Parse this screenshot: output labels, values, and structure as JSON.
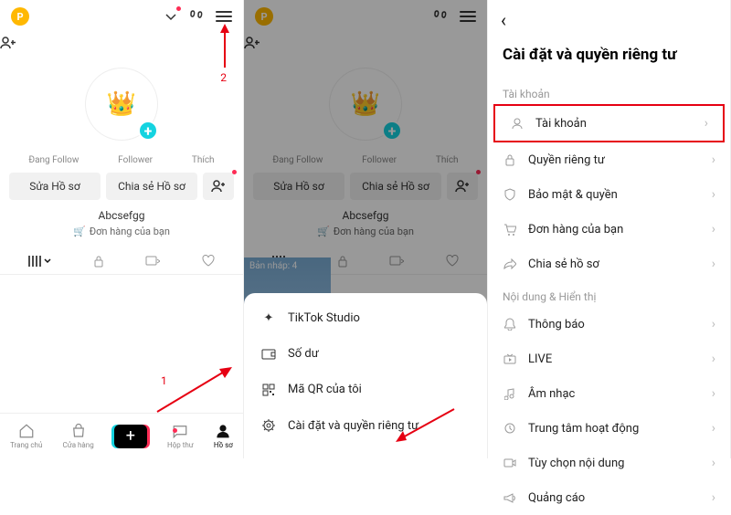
{
  "panel1": {
    "stats": [
      "Đang Follow",
      "Follower",
      "Thích"
    ],
    "buttons": {
      "edit": "Sửa Hồ sơ",
      "share": "Chia sẻ Hồ sơ"
    },
    "username": "Abcsefgg",
    "orders": "Đơn hàng của bạn",
    "nav": {
      "home": "Trang chủ",
      "shop": "Cửa hàng",
      "inbox": "Hộp thư",
      "profile": "Hồ sơ"
    },
    "annot": {
      "n1": "1",
      "n2": "2"
    }
  },
  "panel2": {
    "stats": [
      "Đang Follow",
      "Follower",
      "Thích"
    ],
    "buttons": {
      "edit": "Sửa Hồ sơ",
      "share": "Chia sẻ Hồ sơ"
    },
    "username": "Abcsefgg",
    "orders": "Đơn hàng của bạn",
    "draft": "Bản nháp: 4",
    "sheet": {
      "studio": "TikTok Studio",
      "balance": "Số dư",
      "qr": "Mã QR của tôi",
      "settings": "Cài đặt và quyền riêng tư"
    }
  },
  "panel3": {
    "title": "Cài đặt và quyền riêng tư",
    "sect1": "Tài khoản",
    "items1": {
      "account": "Tài khoản",
      "privacy": "Quyền riêng tư",
      "security": "Bảo mật & quyền",
      "orders": "Đơn hàng của bạn",
      "share": "Chia sẻ hồ sơ"
    },
    "sect2": "Nội dung & Hiển thị",
    "items2": {
      "notif": "Thông báo",
      "live": "LIVE",
      "music": "Âm nhạc",
      "activity": "Trung tâm hoạt động",
      "content": "Tùy chọn nội dung",
      "ads": "Quảng cáo"
    }
  }
}
